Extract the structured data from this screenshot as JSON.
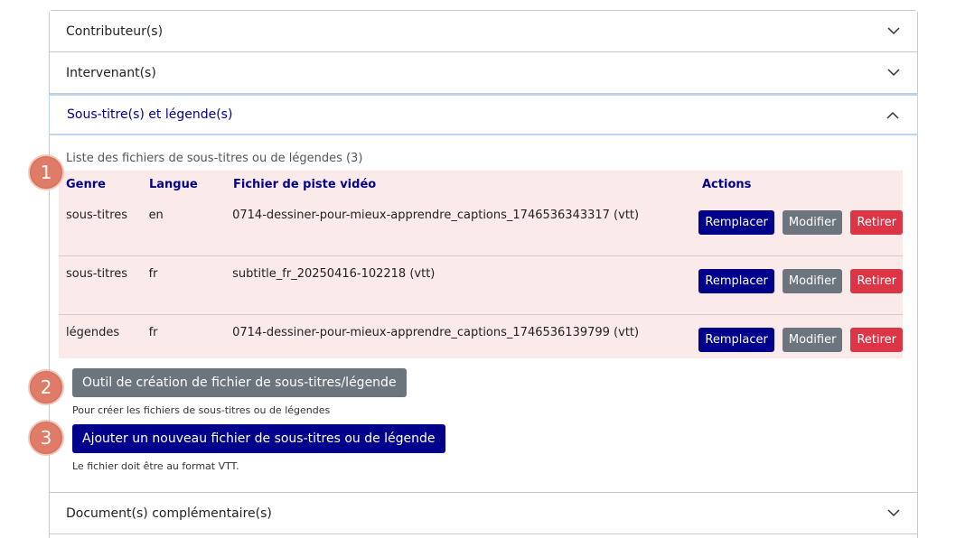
{
  "sections": {
    "contributors": "Contributeur(s)",
    "speakers": "Intervenant(s)",
    "subtitles": "Sous-titre(s) et légende(s)",
    "documents": "Document(s) complémentaire(s)"
  },
  "subtitles_panel": {
    "caption": "Liste des fichiers de sous-titres ou de légendes (3)",
    "columns": [
      "Genre",
      "Langue",
      "Fichier de piste vidéo",
      "Actions"
    ],
    "rows": [
      {
        "genre": "sous-titres",
        "lang": "en",
        "file": "0714-dessiner-pour-mieux-apprendre_captions_1746536343317 (vtt)"
      },
      {
        "genre": "sous-titres",
        "lang": "fr",
        "file": "subtitle_fr_20250416-102218 (vtt)"
      },
      {
        "genre": "légendes",
        "lang": "fr",
        "file": "0714-dessiner-pour-mieux-apprendre_captions_1746536139799 (vtt)"
      }
    ],
    "actions": {
      "replace": "Remplacer",
      "edit": "Modifier",
      "remove": "Retirer"
    },
    "tool_button": "Outil de création de fichier de sous-titres/légende",
    "tool_help": "Pour créer les fichiers de sous-titres ou de légendes",
    "add_button": "Ajouter un nouveau fichier de sous-titres ou de légende",
    "add_help": "Le fichier doit être au format VTT."
  },
  "badges": [
    "1",
    "2",
    "3"
  ],
  "colors": {
    "navy": "#00008b",
    "gray": "#6c757d",
    "red": "#dc3545",
    "table_bg": "#fbeaea",
    "badge": "#e07b67"
  }
}
